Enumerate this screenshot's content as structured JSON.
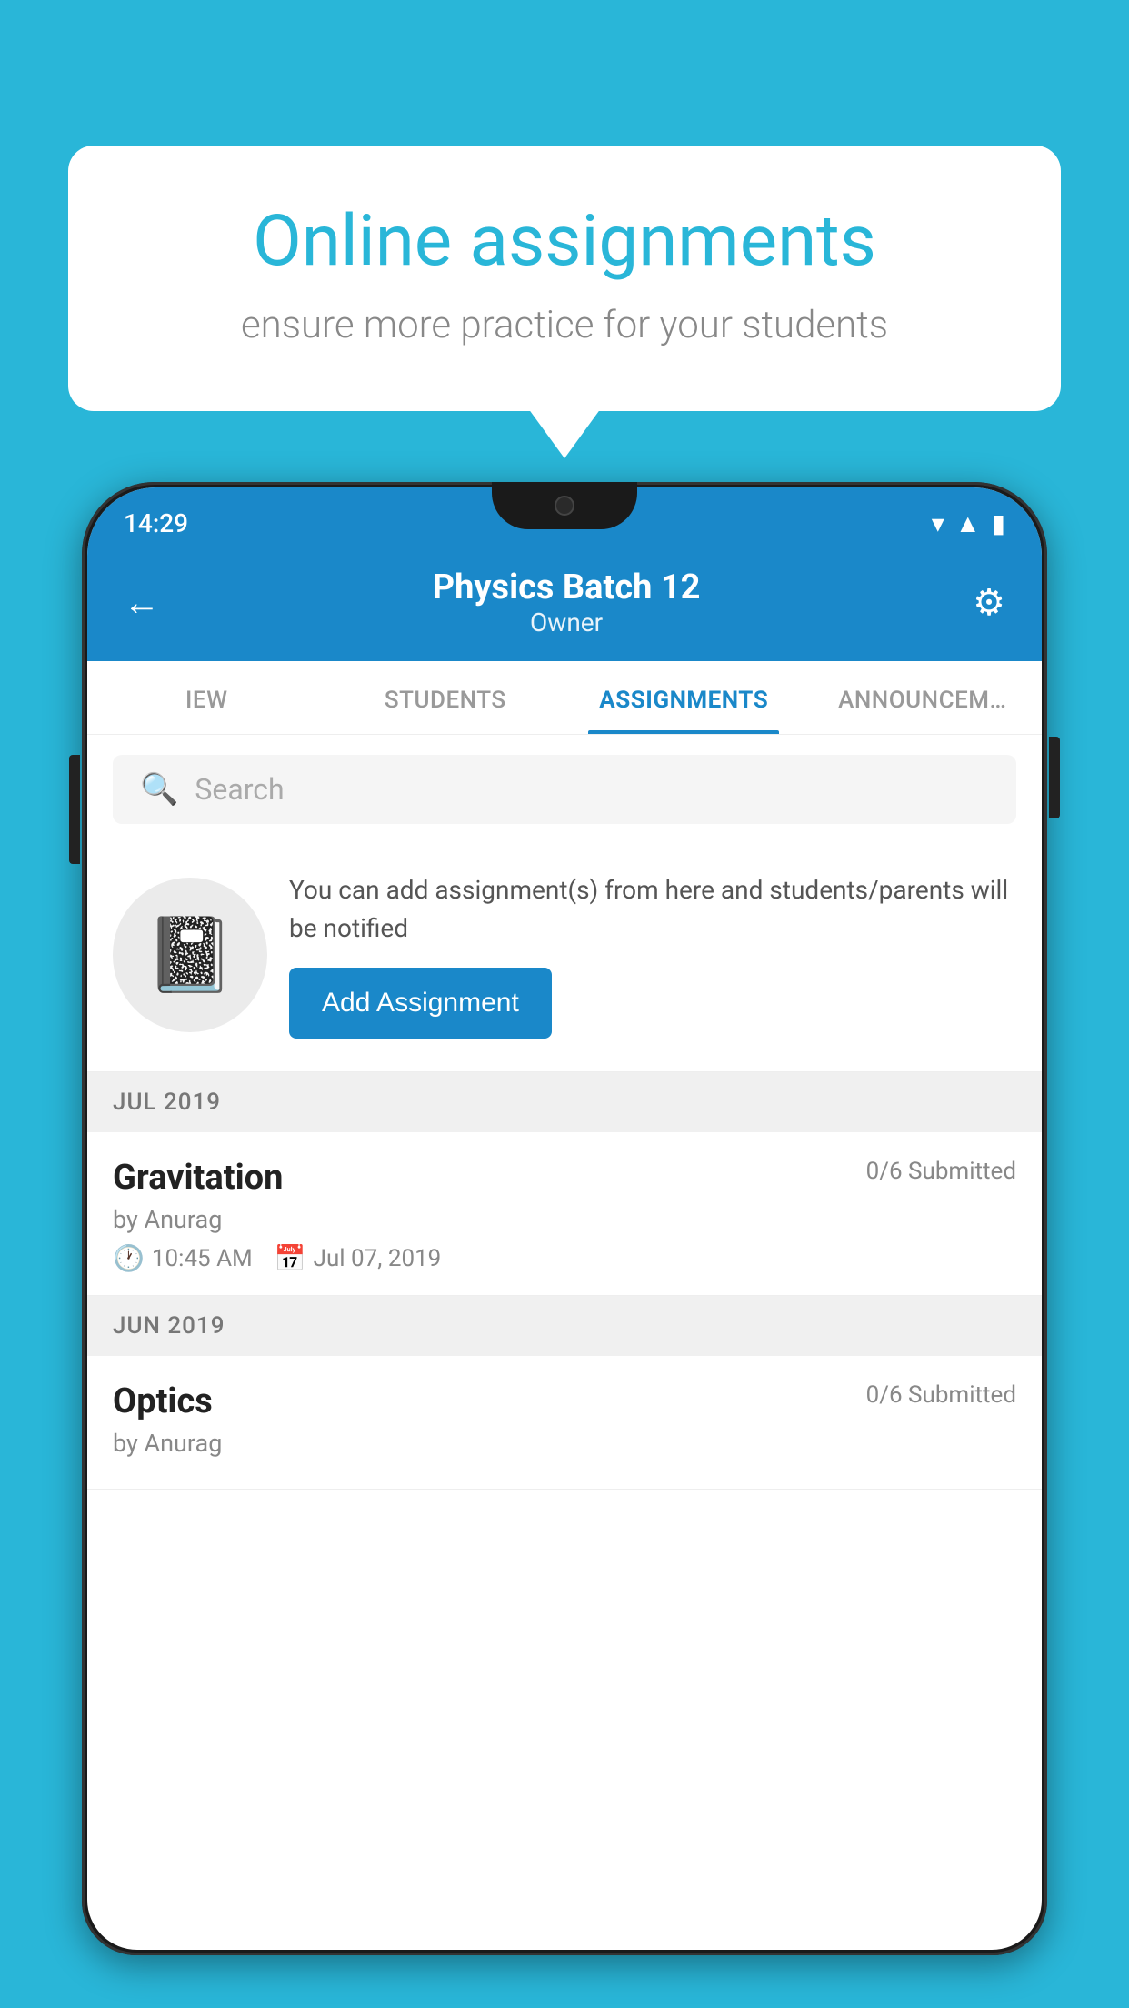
{
  "background_color": "#29b6d8",
  "speech_bubble": {
    "title": "Online assignments",
    "subtitle": "ensure more practice for your students"
  },
  "status_bar": {
    "time": "14:29",
    "icons": [
      "wifi",
      "signal",
      "battery"
    ]
  },
  "header": {
    "title": "Physics Batch 12",
    "subtitle": "Owner",
    "back_label": "←",
    "settings_label": "⚙"
  },
  "tabs": [
    {
      "label": "IEW",
      "active": false
    },
    {
      "label": "STUDENTS",
      "active": false
    },
    {
      "label": "ASSIGNMENTS",
      "active": true
    },
    {
      "label": "ANNOUNCEM…",
      "active": false
    }
  ],
  "search": {
    "placeholder": "Search"
  },
  "promo": {
    "text": "You can add assignment(s) from here and students/parents will be notified",
    "button_label": "Add Assignment"
  },
  "sections": [
    {
      "label": "JUL 2019",
      "assignments": [
        {
          "name": "Gravitation",
          "submitted": "0/6 Submitted",
          "author": "by Anurag",
          "time": "10:45 AM",
          "date": "Jul 07, 2019"
        }
      ]
    },
    {
      "label": "JUN 2019",
      "assignments": [
        {
          "name": "Optics",
          "submitted": "0/6 Submitted",
          "author": "by Anurag",
          "time": "",
          "date": ""
        }
      ]
    }
  ]
}
